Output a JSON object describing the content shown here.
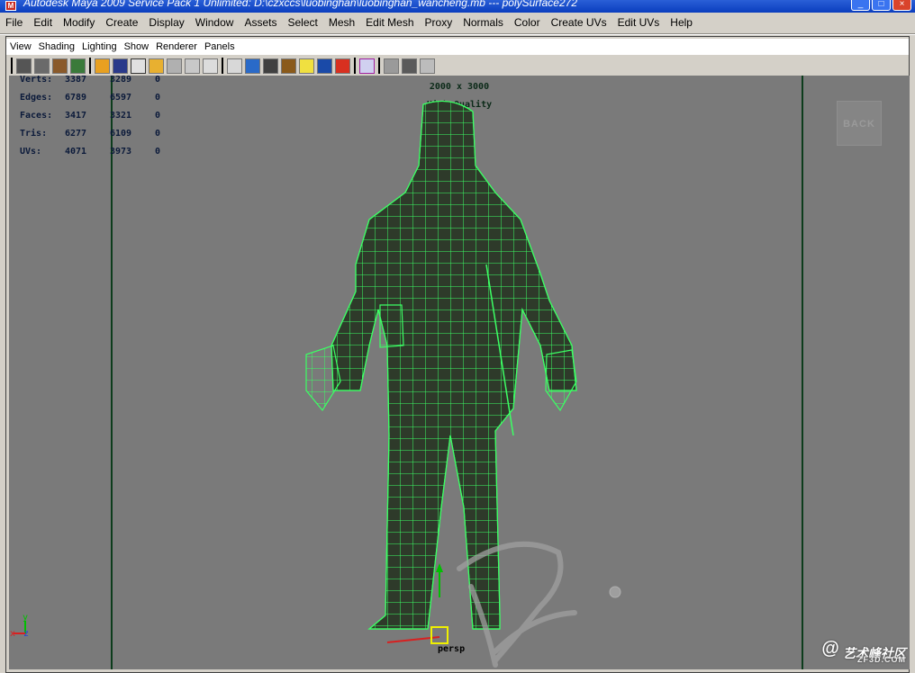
{
  "window": {
    "title": "Autodesk Maya 2009 Service Pack 1 Unlimited: D:\\czxccs\\luobinghan\\luobinghan_wancheng.mb   ---   polySurface272",
    "app_icon": "maya-icon",
    "controls": [
      "minimize",
      "maximize",
      "close"
    ]
  },
  "menubar": {
    "items": [
      "File",
      "Edit",
      "Modify",
      "Create",
      "Display",
      "Window",
      "Assets",
      "Select",
      "Mesh",
      "Edit Mesh",
      "Proxy",
      "Normals",
      "Color",
      "Create UVs",
      "Edit UVs",
      "Help"
    ]
  },
  "panel_menu": {
    "items": [
      "View",
      "Shading",
      "Lighting",
      "Show",
      "Renderer",
      "Panels"
    ]
  },
  "panel_toolbar": {
    "icons": [
      "select-camera-icon",
      "lock-camera-icon",
      "camera-attributes-icon",
      "image-plane-icon",
      "2d-pan-zoom-icon",
      "grid-icon",
      "film-gate-icon",
      "resolution-gate-icon",
      "gate-mask-icon",
      "field-chart-icon",
      "safe-action-icon",
      "safe-title-icon",
      "wireframe-icon",
      "smooth-shade-icon",
      "flat-shade-icon",
      "textured-icon",
      "lighting-icon",
      "shadows-icon",
      "high-quality-icon",
      "isolate-select-icon",
      "xray-icon",
      "xray-joints-icon",
      "backface-icon"
    ]
  },
  "hud": {
    "rows": [
      {
        "label": "Verts:",
        "v1": "3387",
        "v2": "3289",
        "v3": "0"
      },
      {
        "label": "Edges:",
        "v1": "6789",
        "v2": "6597",
        "v3": "0"
      },
      {
        "label": "Faces:",
        "v1": "3417",
        "v2": "3321",
        "v3": "0"
      },
      {
        "label": "Tris:",
        "v1": "6277",
        "v2": "6109",
        "v3": "0"
      },
      {
        "label": "UVs:",
        "v1": "4071",
        "v2": "3973",
        "v3": "0"
      }
    ],
    "resolution": "2000 x 3000",
    "quality": "High Quality",
    "camera": "persp"
  },
  "viewport": {
    "back_button": "BACK",
    "axis_labels": {
      "x": "x",
      "y": "y",
      "z": "z"
    },
    "model_color": "#3cff64",
    "background": "#7a7a7a"
  },
  "watermark": {
    "logo_text": "艺术峰社区",
    "sub_text": "ZF3D.COM"
  }
}
